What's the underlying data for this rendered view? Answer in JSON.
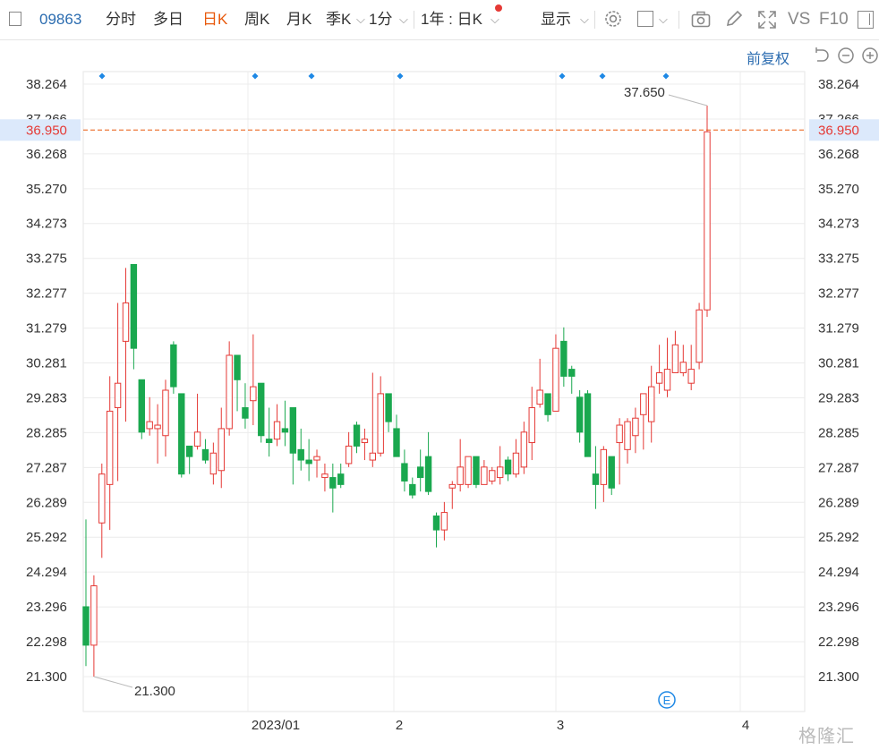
{
  "toolbar": {
    "code": "09863",
    "tabs": [
      "分时",
      "多日",
      "日K",
      "周K",
      "月K"
    ],
    "active_tab": "日K",
    "season": "季K",
    "minute": "1分",
    "range": "1年 : 日K",
    "display": "显示",
    "vs": "VS",
    "f10": "F10"
  },
  "adjust_label": "前复权",
  "watermark": "格隆汇",
  "colors": {
    "up": "#e53935",
    "down": "#1aa84f",
    "accent": "#2b6cb0",
    "current": "#e8590c"
  },
  "chart_data": {
    "type": "candlestick",
    "y_ticks": [
      "38.264",
      "37.266",
      "36.268",
      "35.270",
      "34.273",
      "33.275",
      "32.277",
      "31.279",
      "30.281",
      "29.283",
      "28.285",
      "27.287",
      "26.289",
      "25.292",
      "24.294",
      "23.296",
      "22.298",
      "21.300"
    ],
    "ylim": [
      20.6,
      38.6
    ],
    "x_labels": [
      "2023/01",
      "2",
      "3",
      "4"
    ],
    "current_price": "36.950",
    "max_label": "37.650",
    "min_label": "21.300",
    "event_marker": "E",
    "candles": [
      [
        23.3,
        22.2,
        25.8,
        21.6
      ],
      [
        22.2,
        23.9,
        24.2,
        21.3
      ],
      [
        25.7,
        27.1,
        27.4,
        24.7
      ],
      [
        26.8,
        28.9,
        29.9,
        25.5
      ],
      [
        29.0,
        29.7,
        32.0,
        26.9
      ],
      [
        30.9,
        32.0,
        33.0,
        28.6
      ],
      [
        33.1,
        30.7,
        31.2,
        30.1
      ],
      [
        29.8,
        28.3,
        29.8,
        28.1
      ],
      [
        28.4,
        28.6,
        29.3,
        28.2
      ],
      [
        28.4,
        28.5,
        29.1,
        27.4
      ],
      [
        28.2,
        29.5,
        29.8,
        27.6
      ],
      [
        30.8,
        29.6,
        30.9,
        29.4
      ],
      [
        29.4,
        27.1,
        29.4,
        27.0
      ],
      [
        27.9,
        27.6,
        27.9,
        27.1
      ],
      [
        27.9,
        28.3,
        29.4,
        27.8
      ],
      [
        27.8,
        27.5,
        28.1,
        27.4
      ],
      [
        27.1,
        27.7,
        28.0,
        26.8
      ],
      [
        27.2,
        28.4,
        29.0,
        26.7
      ],
      [
        28.4,
        30.5,
        30.9,
        28.2
      ],
      [
        30.5,
        29.8,
        30.5,
        28.9
      ],
      [
        29.0,
        28.7,
        29.7,
        28.4
      ],
      [
        29.2,
        29.6,
        31.1,
        28.5
      ],
      [
        29.7,
        28.2,
        29.7,
        28.0
      ],
      [
        28.1,
        28.0,
        29.0,
        27.6
      ],
      [
        28.1,
        28.6,
        29.1,
        27.9
      ],
      [
        28.4,
        28.3,
        29.2,
        27.9
      ],
      [
        29.0,
        27.7,
        29.0,
        26.8
      ],
      [
        27.8,
        27.5,
        28.4,
        27.2
      ],
      [
        27.5,
        27.4,
        28.1,
        26.9
      ],
      [
        27.5,
        27.6,
        27.8,
        27.0
      ],
      [
        27.0,
        27.1,
        27.4,
        26.6
      ],
      [
        27.0,
        26.7,
        27.4,
        26.0
      ],
      [
        27.1,
        26.8,
        27.4,
        26.7
      ],
      [
        27.4,
        27.9,
        28.3,
        27.3
      ],
      [
        28.5,
        27.9,
        28.6,
        27.7
      ],
      [
        28.0,
        28.1,
        28.4,
        27.5
      ],
      [
        27.5,
        27.7,
        30.0,
        27.3
      ],
      [
        27.7,
        29.4,
        29.9,
        27.6
      ],
      [
        29.4,
        28.6,
        29.4,
        28.3
      ],
      [
        28.4,
        27.6,
        28.8,
        27.6
      ],
      [
        27.4,
        26.9,
        27.8,
        26.6
      ],
      [
        26.8,
        26.5,
        27.0,
        26.4
      ],
      [
        27.3,
        27.0,
        27.8,
        26.6
      ],
      [
        27.6,
        26.6,
        28.3,
        26.5
      ],
      [
        25.9,
        25.5,
        26.0,
        25.0
      ],
      [
        25.5,
        26.0,
        26.3,
        25.2
      ],
      [
        26.7,
        26.8,
        26.9,
        26.1
      ],
      [
        26.8,
        27.3,
        28.1,
        26.6
      ],
      [
        26.8,
        27.6,
        27.6,
        26.7
      ],
      [
        27.6,
        26.8,
        27.6,
        26.7
      ],
      [
        26.8,
        27.3,
        27.5,
        26.8
      ],
      [
        26.9,
        27.2,
        27.3,
        26.8
      ],
      [
        27.0,
        27.3,
        27.9,
        26.8
      ],
      [
        27.5,
        27.1,
        27.6,
        26.9
      ],
      [
        27.1,
        27.7,
        28.1,
        27.0
      ],
      [
        27.3,
        28.3,
        28.6,
        27.1
      ],
      [
        28.0,
        29.0,
        29.6,
        27.5
      ],
      [
        29.1,
        29.5,
        30.4,
        29.0
      ],
      [
        29.4,
        28.8,
        29.4,
        28.6
      ],
      [
        28.9,
        30.7,
        31.1,
        28.9
      ],
      [
        30.9,
        29.9,
        31.3,
        29.6
      ],
      [
        30.1,
        29.9,
        30.2,
        29.4
      ],
      [
        29.3,
        28.3,
        29.5,
        28.0
      ],
      [
        29.4,
        27.6,
        29.5,
        27.6
      ],
      [
        27.1,
        26.8,
        27.9,
        26.1
      ],
      [
        26.8,
        27.8,
        27.9,
        26.3
      ],
      [
        27.6,
        26.7,
        27.6,
        26.5
      ],
      [
        28.0,
        28.5,
        28.7,
        26.8
      ],
      [
        27.8,
        28.6,
        28.7,
        27.4
      ],
      [
        28.2,
        28.7,
        29.0,
        27.7
      ],
      [
        28.8,
        29.4,
        29.4,
        27.8
      ],
      [
        28.6,
        29.6,
        30.2,
        28.0
      ],
      [
        29.7,
        30.0,
        30.8,
        29.4
      ],
      [
        29.5,
        30.1,
        31.0,
        29.3
      ],
      [
        30.0,
        30.8,
        31.2,
        30.0
      ],
      [
        30.0,
        30.3,
        30.8,
        29.9
      ],
      [
        29.7,
        30.1,
        30.8,
        29.5
      ],
      [
        30.3,
        31.8,
        32.0,
        30.1
      ],
      [
        31.8,
        36.9,
        37.65,
        31.6
      ]
    ]
  }
}
